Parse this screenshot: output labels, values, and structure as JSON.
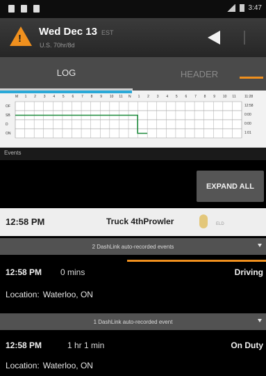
{
  "status_bar": {
    "time": "3:47"
  },
  "header": {
    "date": "Wed Dec 13",
    "timezone": "EST",
    "ruleset": "U.S. 70hr/8d",
    "warning_icon": "warning-triangle-icon",
    "back_icon": "back-arrow-icon"
  },
  "tabs": [
    {
      "label": "LOG",
      "active": true
    },
    {
      "label": "HEADER",
      "active": false
    }
  ],
  "chart_data": {
    "type": "line",
    "hours": [
      "M",
      "1",
      "2",
      "3",
      "4",
      "5",
      "6",
      "7",
      "8",
      "9",
      "10",
      "11",
      "N",
      "1",
      "2",
      "3",
      "4",
      "5",
      "6",
      "7",
      "8",
      "9",
      "10",
      "11"
    ],
    "rows": [
      "OF",
      "SB",
      "D",
      "ON"
    ],
    "totals": [
      "11:28",
      "12:58",
      "0:00",
      "0:00",
      "1:01"
    ],
    "segments": [
      {
        "status": "SB",
        "start": 0,
        "end": 12.97
      },
      {
        "status": "D",
        "start": 12.97,
        "end": 12.97
      },
      {
        "status": "ON",
        "start": 12.97,
        "end": 14.0
      }
    ],
    "colors": {
      "line": "#1e8a3c",
      "accent": "#2aa9d8"
    }
  },
  "events_section": {
    "label": "Events",
    "expand_label": "EXPAND ALL"
  },
  "truck_row": {
    "time": "12:58 PM",
    "name": "Truck 4thProwler",
    "sub": "ELD"
  },
  "auto_bars": [
    {
      "text": "2 DashLink auto-recorded events"
    },
    {
      "text": "1 DashLink auto-recorded event"
    }
  ],
  "events": [
    {
      "time": "12:58 PM",
      "duration": "0 mins",
      "status": "Driving",
      "location_label": "Location:",
      "location": "Waterloo, ON"
    },
    {
      "time": "12:58 PM",
      "duration": "1 hr 1 min",
      "status": "On Duty",
      "location_label": "Location:",
      "location": "Waterloo, ON"
    }
  ],
  "colors": {
    "accent_orange": "#f0901e",
    "accent_blue": "#2aa9d8"
  }
}
